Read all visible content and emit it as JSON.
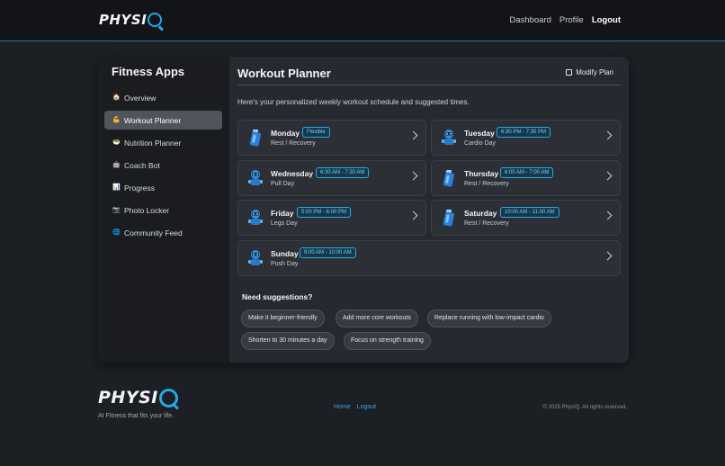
{
  "brand": {
    "name": "PHYSI",
    "q": "Q",
    "tagline": "AI Fitness that fits your life."
  },
  "nav": {
    "dashboard": "Dashboard",
    "profile": "Profile",
    "logout": "Logout"
  },
  "sidebar": {
    "title": "Fitness Apps",
    "items": [
      {
        "label": "Overview",
        "icon": "home-icon",
        "glyph": "🏠"
      },
      {
        "label": "Workout Planner",
        "icon": "flex-arm-icon",
        "glyph": "💪"
      },
      {
        "label": "Nutrition Planner",
        "icon": "bowl-icon",
        "glyph": "🥗"
      },
      {
        "label": "Coach Bot",
        "icon": "bot-icon",
        "glyph": "🤖"
      },
      {
        "label": "Progress",
        "icon": "chart-icon",
        "glyph": "📊"
      },
      {
        "label": "Photo Locker",
        "icon": "photo-icon",
        "glyph": "📷"
      },
      {
        "label": "Community Feed",
        "icon": "globe-icon",
        "glyph": "🌐"
      }
    ]
  },
  "main": {
    "title": "Workout Planner",
    "modify_label": "Modify Plan",
    "intro": "Here's your personalized weekly workout schedule and suggested times.",
    "days": [
      {
        "day": "Monday",
        "badge": "Flexible",
        "sub": "Rest / Recovery",
        "avatar": "bottle"
      },
      {
        "day": "Tuesday",
        "badge": "6:30 PM - 7:30 PM",
        "sub": "Cardio Day",
        "avatar": "bot"
      },
      {
        "day": "Wednesday",
        "badge": "6:30 AM - 7:30 AM",
        "sub": "Pull Day",
        "avatar": "bot"
      },
      {
        "day": "Thursday",
        "badge": "6:00 AM - 7:00 AM",
        "sub": "Rest / Recovery",
        "avatar": "bottle"
      },
      {
        "day": "Friday",
        "badge": "5:00 PM - 6:00 PM",
        "sub": "Legs Day",
        "avatar": "bot"
      },
      {
        "day": "Saturday",
        "badge": "10:00 AM - 11:00 AM",
        "sub": "Rest / Recovery",
        "avatar": "bottle"
      },
      {
        "day": "Sunday",
        "badge": "9:00 AM - 10:00 AM",
        "sub": "Push Day",
        "avatar": "bot"
      }
    ],
    "suggestions_title": "Need suggestions?",
    "suggestions": [
      "Make it beginner-friendly",
      "Add more core workouts",
      "Replace running with low-impact cardio",
      "Shorten to 30 minutes a day",
      "Focus on strength training"
    ]
  },
  "footer": {
    "home": "Home",
    "logout": "Logout",
    "copyright": "© 2025 PhysIQ. All rights reserved."
  },
  "colors": {
    "accent": "#2da7e0",
    "background": "#1c1f24"
  }
}
